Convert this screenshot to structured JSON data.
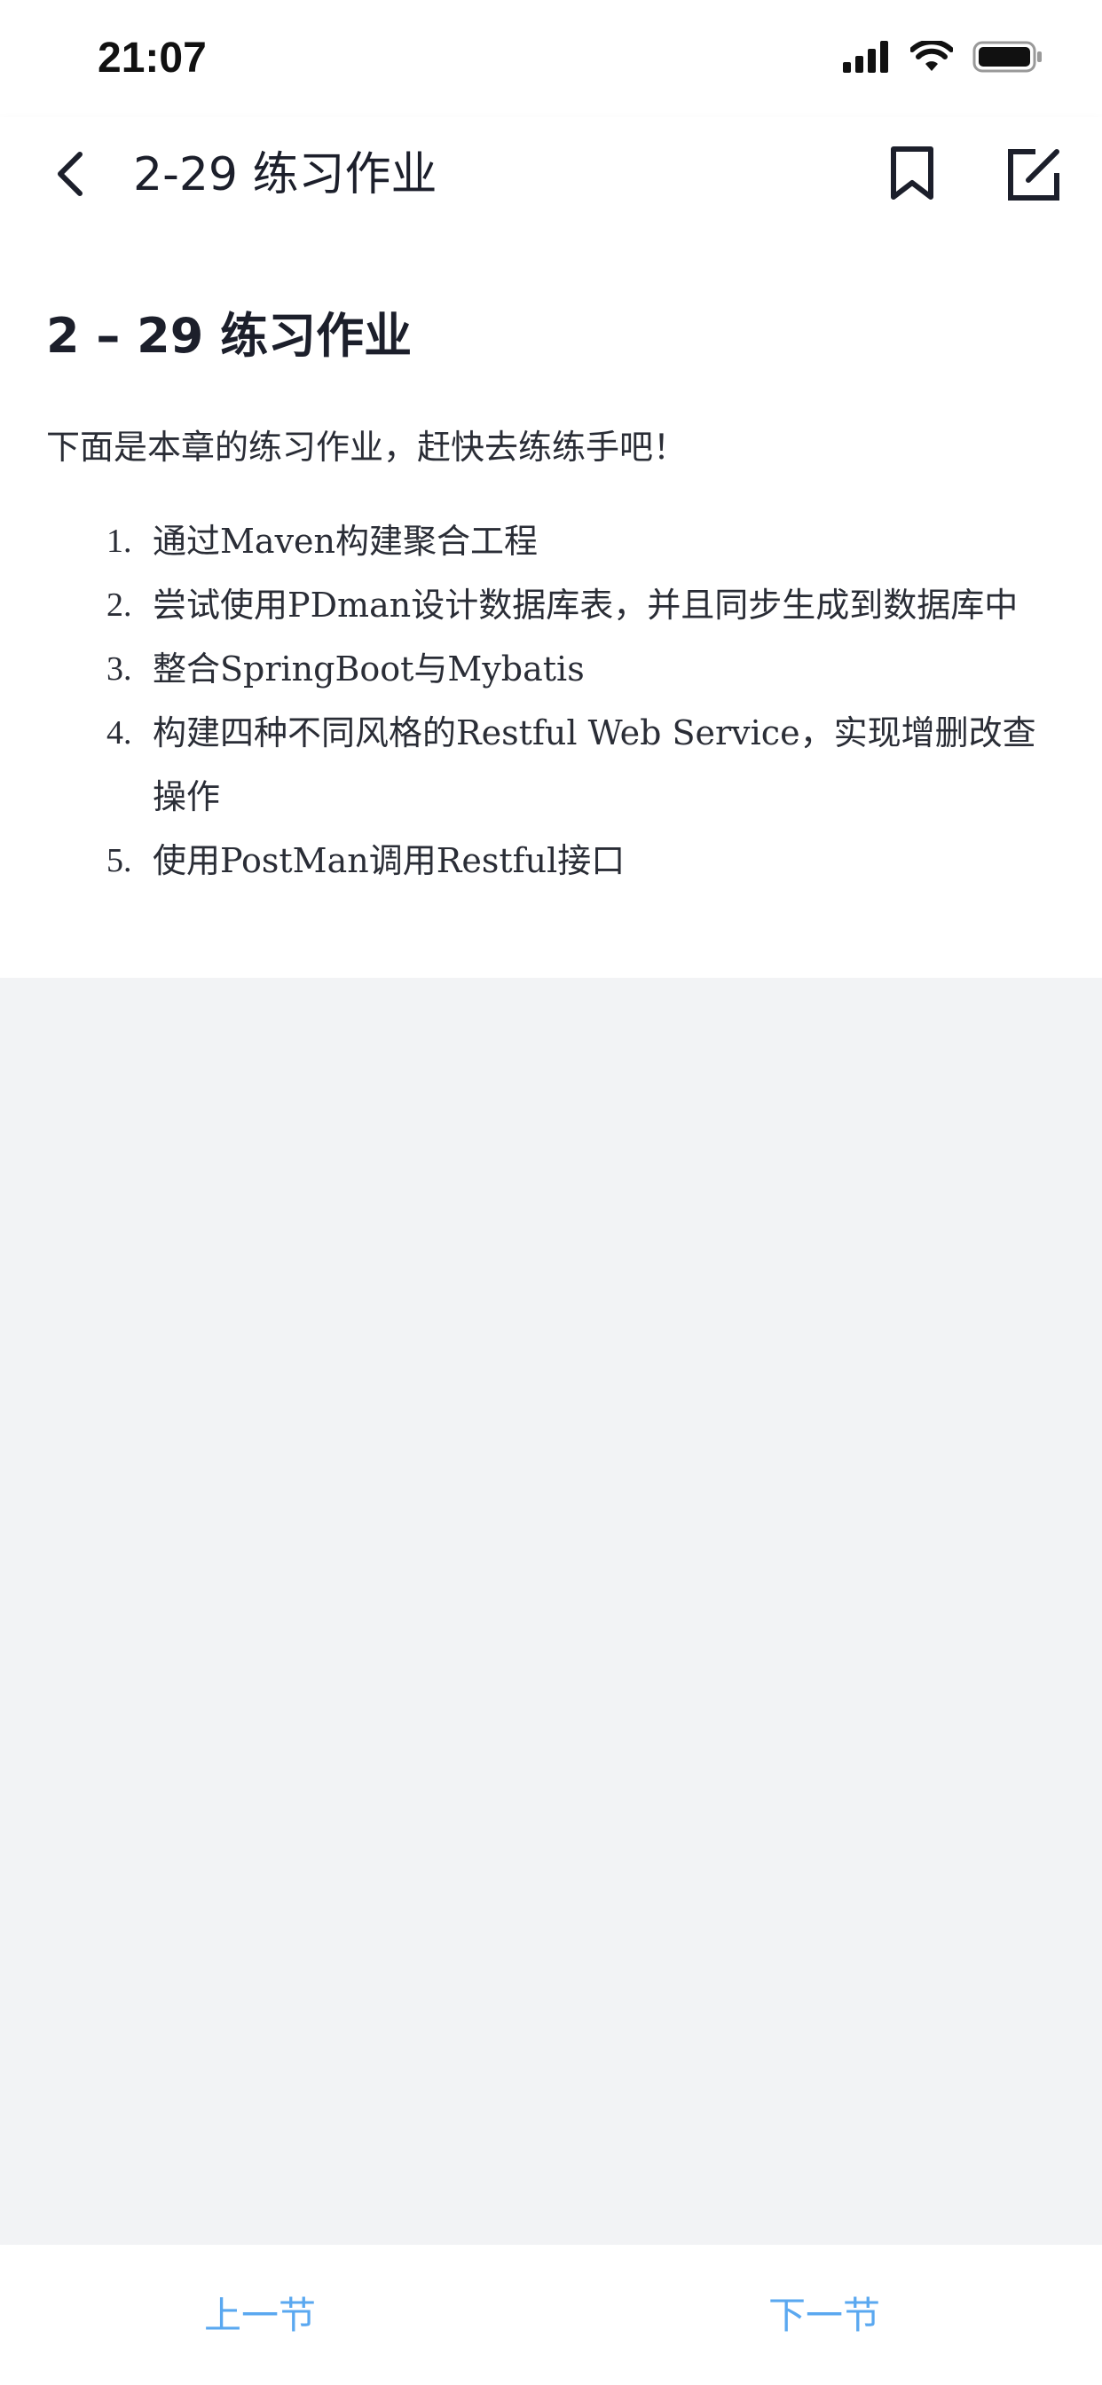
{
  "status_bar": {
    "time": "21:07"
  },
  "nav": {
    "title": "2-29 练习作业",
    "icons": [
      "back-arrow-icon",
      "bookmark-icon",
      "edit-icon"
    ]
  },
  "article": {
    "title": "2 – 29 练习作业",
    "intro": "下面是本章的练习作业，赶快去练练手吧！",
    "tasks": [
      {
        "num": "1.",
        "text": "通过Maven构建聚合工程"
      },
      {
        "num": "2.",
        "text": "尝试使用PDman设计数据库表，并且同步生成到数据库中"
      },
      {
        "num": "3.",
        "text": "整合SpringBoot与Mybatis"
      },
      {
        "num": "4.",
        "text": "构建四种不同风格的Restful Web Service，实现增删改查操作"
      },
      {
        "num": "5.",
        "text": "使用PostMan调用Restful接口"
      }
    ]
  },
  "footer": {
    "prev_label": "上一节",
    "next_label": "下一节"
  },
  "colors": {
    "accent": "#5aa8f0",
    "background": "#f2f3f5",
    "text": "#1c1f2b"
  }
}
